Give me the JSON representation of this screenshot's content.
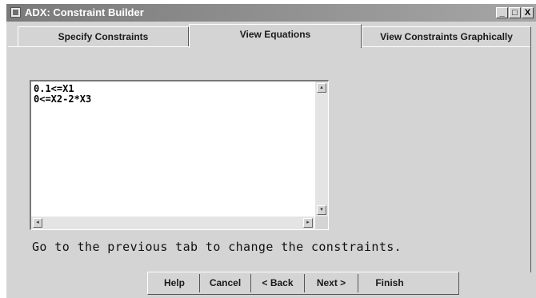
{
  "window": {
    "title": "ADX: Constraint Builder",
    "controls": [
      "_",
      "□",
      "X"
    ]
  },
  "tabs": [
    {
      "label": "Specify Constraints",
      "active": false
    },
    {
      "label": "View Equations",
      "active": true
    },
    {
      "label": "View Constraints Graphically",
      "active": false
    }
  ],
  "equations": {
    "lines": [
      "0.1<=X1",
      "0<=X2-2*X3"
    ]
  },
  "hint": "Go to the previous tab to change the constraints.",
  "buttons": {
    "help": "Help",
    "cancel": "Cancel",
    "back": "< Back",
    "next": "Next >",
    "finish": "Finish"
  },
  "colors": {
    "background": "#d4d4d4",
    "titlebar": "#8c8c8c",
    "text": "#1a1a1a"
  }
}
